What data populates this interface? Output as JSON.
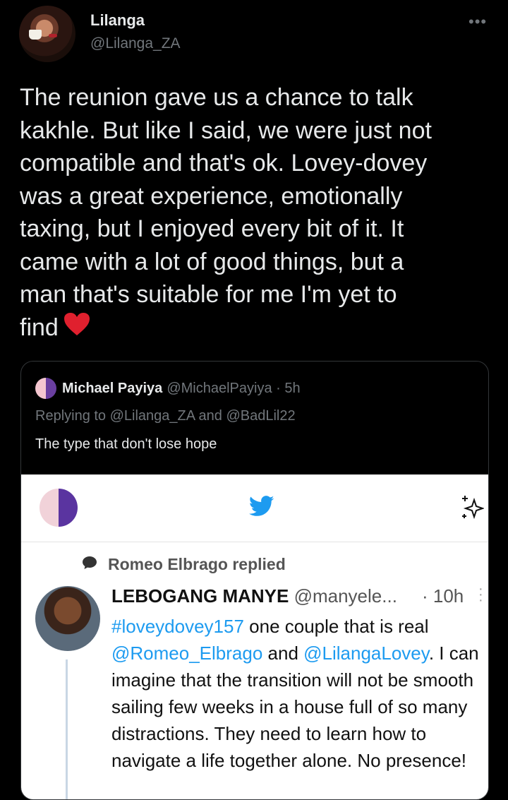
{
  "author": {
    "name": "Lilanga",
    "handle": "@Lilanga_ZA",
    "more_icon": "more-dots-icon"
  },
  "tweet": {
    "text": "The reunion gave us a chance to talk\nkakhle. But like I said, we were just not\ncompatible and that's ok. Lovey-dovey\nwas a great experience, emotionally\ntaxing, but I enjoyed every bit of it. It\ncame with a lot of good things, but a\nman that's suitable for me I'm yet to\nfind",
    "emoji": "heart-emoji",
    "heart_color": "#e0202e"
  },
  "quoted": {
    "name": "Michael Payiya",
    "handle": "@MichaelPayiya · 5h",
    "replying": "Replying to @Lilanga_ZA and @BadLil22",
    "text": "The type that don't lose hope"
  },
  "embed": {
    "replied_label": "Romeo Elbrago replied",
    "reply": {
      "name": "LEBOGANG MANYE",
      "handle": "@manyele...",
      "time": "· 10h",
      "hashtag": "#loveydovey157",
      "text_1": " one couple that is real",
      "mention_1": "@Romeo_Elbrago",
      "and_word": " and ",
      "mention_2": "@LilangaLovey",
      "text_2": ". I can imagine that the transition will not be smooth sailing few weeks in a house full of so many distractions. They need to learn how to navigate a life together alone. No presence!"
    },
    "accent_color": "#1d9bf0"
  }
}
